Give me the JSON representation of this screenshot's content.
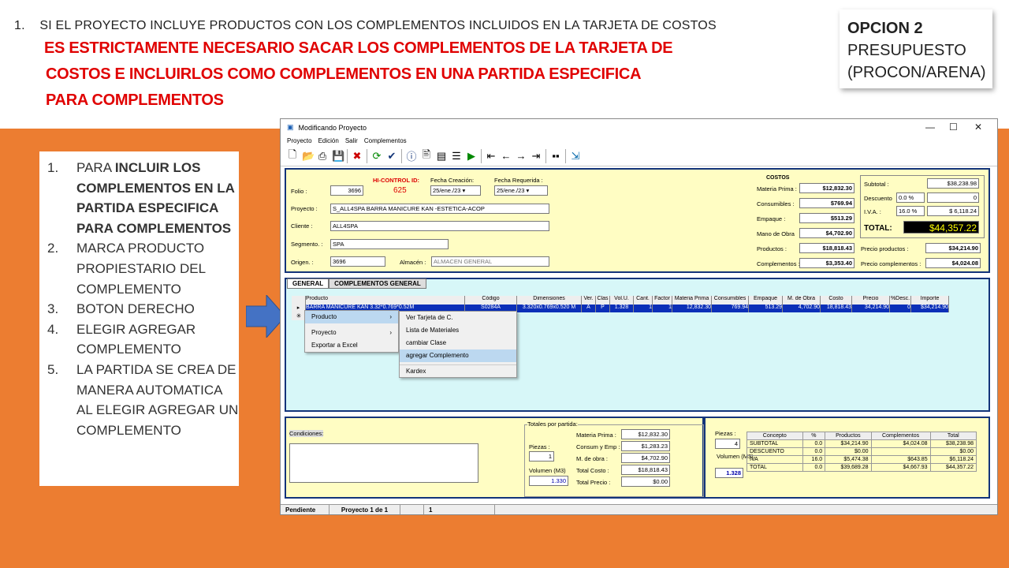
{
  "slide": {
    "step_number": "1.",
    "step_text": "SI EL PROYECTO INCLUYE PRODUCTOS CON LOS COMPLEMENTOS INCLUIDOS EN LA TARJETA DE COSTOS",
    "red_lines": [
      "ES ESTRICTAMENTE NECESARIO SACAR LOS COMPLEMENTOS DE LA TARJETA DE",
      "COSTOS E INCLUIRLOS COMO COMPLEMENTOS EN UNA PARTIDA ESPECIFICA",
      "PARA COMPLEMENTOS"
    ],
    "option_title": "OPCION 2",
    "option_line2": "PRESUPUESTO",
    "option_line3": "(PROCON/ARENA)",
    "steps": [
      {
        "n": "1.",
        "pre": "PARA ",
        "bold": "INCLUIR LOS COMPLEMENTOS EN LA PARTIDA ESPECIFICA PARA COMPLEMENTOS"
      },
      {
        "n": "2.",
        "pre": "MARCA PRODUCTO PROPIESTARIO DEL COMPLEMENTO",
        "bold": ""
      },
      {
        "n": "3.",
        "pre": "BOTON DERECHO",
        "bold": ""
      },
      {
        "n": "4.",
        "pre": "ELEGIR AGREGAR COMPLEMENTO",
        "bold": ""
      },
      {
        "n": "5.",
        "pre": "LA PARTIDA SE CREA DE MANERA AUTOMATICA AL ELEGIR AGREGAR UN COMPLEMENTO",
        "bold": ""
      }
    ]
  },
  "window": {
    "title": "Modificando Proyecto",
    "menu": [
      "Proyecto",
      "Edición",
      "Salir",
      "Complementos"
    ],
    "folio_label": "Folio :",
    "folio": "3696",
    "hicontrol_label": "HI-CONTROL ID:",
    "hicontrol": "625",
    "fecha_creacion_label": "Fecha Creación:",
    "fecha_creacion": "25/ene./23",
    "fecha_requerida_label": "Fecha Requerida :",
    "fecha_requerida": "25/ene./23",
    "proyecto_label": "Proyecto :",
    "proyecto": "S_ALL4SPA BARRA MANICURE KAN -ESTETICA-ACOP",
    "cliente_label": "Cliente :",
    "cliente": "ALL4SPA",
    "segmento_label": "Segmento. :",
    "segmento": "SPA",
    "origen_label": "Origen. :",
    "origen": "3696",
    "almacen_label": "Almacén :",
    "almacen": "ALMACEN GENERAL",
    "costos_title": "COSTOS",
    "costos": [
      [
        "Materia Prima :",
        "$12,832.30"
      ],
      [
        "Consumibles :",
        "$769.94"
      ],
      [
        "Empaque :",
        "$513.29"
      ],
      [
        "Mano de Obra",
        "$4,702.90"
      ],
      [
        "Productos :",
        "$18,818.43"
      ],
      [
        "Complementos :",
        "$3,353.40"
      ]
    ],
    "subtotal_label": "Subtotal :",
    "subtotal": "$38,238.98",
    "descuento_label": "Descuento",
    "descuento_pct": "0.0 %",
    "descuento": "0",
    "iva_label": "I.V.A. :",
    "iva_pct": "16.0 %",
    "iva": "$ 6,118.24",
    "total_label": "TOTAL:",
    "total": "$44,357.22",
    "precio_productos_label": "Precio productos :",
    "precio_productos": "$34,214.90",
    "precio_complementos_label": "Precio complementos :",
    "precio_complementos": "$4,024.08",
    "tabs": [
      "GENERAL",
      "COMPLEMENTOS GENERAL"
    ],
    "columns": [
      "Producto",
      "Código",
      "Dimensiones",
      "Ver.",
      "Clas",
      "Vol.U.",
      "Cant.",
      "Factor",
      "Materia Prima",
      "Consumibles",
      "Empaque",
      "M. de Obra",
      "Costo",
      "Precio",
      "%Desc.",
      "Importe"
    ],
    "row": [
      "BARRA MANICURE KAN 3.32*0.769*0.52M",
      "S0284A",
      "3.320x0.769x0.520 M",
      "A",
      "P",
      "1.328",
      "1",
      "1",
      "12,832.30",
      "769.94",
      "513.29",
      "4,702.90",
      "18,818.43",
      "34,214.90",
      "0",
      "$34,214.90"
    ],
    "ctx_main": [
      "Producto",
      "Proyecto",
      "Exportar a Excel"
    ],
    "ctx_sub": [
      "Ver Tarjeta de C.",
      "Lista de Materiales",
      "cambiar Clase",
      "agregar Complemento",
      "Kardex"
    ],
    "condiciones_label": "Condiciones:",
    "totales_title": "Totales por partida:",
    "piezas_label": "Piezas :",
    "piezas": "1",
    "volumen_label": "Volumen (M3)",
    "volumen": "1.330",
    "totales": [
      [
        "Materia Prima :",
        "$12,832.30"
      ],
      [
        "Consum y Emp :",
        "$1,283.23"
      ],
      [
        "M. de obra :",
        "$4,702.90"
      ],
      [
        "Total Costo :",
        "$18,818.43"
      ],
      [
        "Total Precio :",
        "$0.00"
      ]
    ],
    "piezas2": "4",
    "volumen2_label": "Volumen (M3):",
    "volumen2": "1.328",
    "summary_head": [
      "Concepto",
      "%",
      "Productos",
      "Complementos",
      "Total"
    ],
    "summary_rows": [
      [
        "SUBTOTAL",
        "0.0",
        "$34,214.90",
        "$4,024.08",
        "$38,238.98"
      ],
      [
        "DESCUENTO",
        "0.0",
        "$0.00",
        "",
        "$0.00"
      ],
      [
        "IVA",
        "16.0",
        "$5,474.38",
        "$643.85",
        "$6,118.24"
      ],
      [
        "TOTAL",
        "0.0",
        "$39,689.28",
        "$4,667.93",
        "$44,357.22"
      ]
    ],
    "status": [
      "Pendiente",
      "Proyecto 1 de 1",
      "",
      "1"
    ]
  }
}
